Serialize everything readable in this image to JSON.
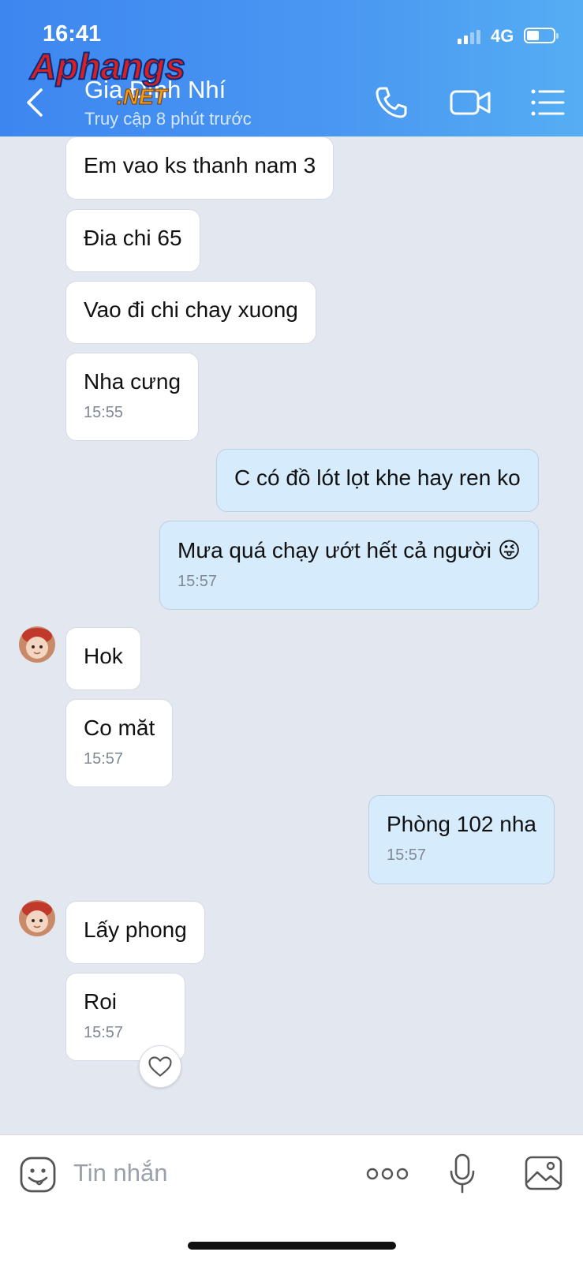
{
  "status_bar": {
    "time": "16:41",
    "network": "4G"
  },
  "watermark": {
    "text_top": "Aphangs",
    "text_bottom": ".NET"
  },
  "header": {
    "contact_name": "Gia Đình Nhí",
    "last_seen": "Truy cập 8 phút trước",
    "icons": [
      "back-icon",
      "phone-icon",
      "video-call-icon",
      "menu-list-icon"
    ]
  },
  "messages": [
    {
      "side": "in",
      "text": "Em vao ks  thanh nam 3"
    },
    {
      "side": "in",
      "text": "Đia chi 65"
    },
    {
      "side": "in",
      "text": "Vao đi chi chay xuong"
    },
    {
      "side": "in",
      "text": "Nha cưng",
      "time": "15:55"
    },
    {
      "side": "out",
      "text": "C có đồ lót lọt khe hay ren ko"
    },
    {
      "side": "out",
      "text": "Mưa quá chạy ướt hết cả người",
      "time": "15:57",
      "emoji": "😜"
    },
    {
      "side": "in",
      "text": "Hok",
      "avatar": true
    },
    {
      "side": "in",
      "text": "Co măt",
      "time": "15:57"
    },
    {
      "side": "out",
      "text": "Phòng 102 nha",
      "time": "15:57"
    },
    {
      "side": "in",
      "text": "Lấy phong",
      "avatar": true
    },
    {
      "side": "in",
      "text": "Roi",
      "time": "15:57",
      "reaction": "heart-icon"
    }
  ],
  "composer": {
    "placeholder": "Tin nhắn",
    "icons": [
      "sticker-icon",
      "more-options-icon",
      "microphone-icon",
      "image-icon"
    ]
  },
  "colors": {
    "header": "#4a98f2",
    "outgoing_bubble": "#d6ebfc",
    "chat_bg": "#e3e7ef"
  }
}
